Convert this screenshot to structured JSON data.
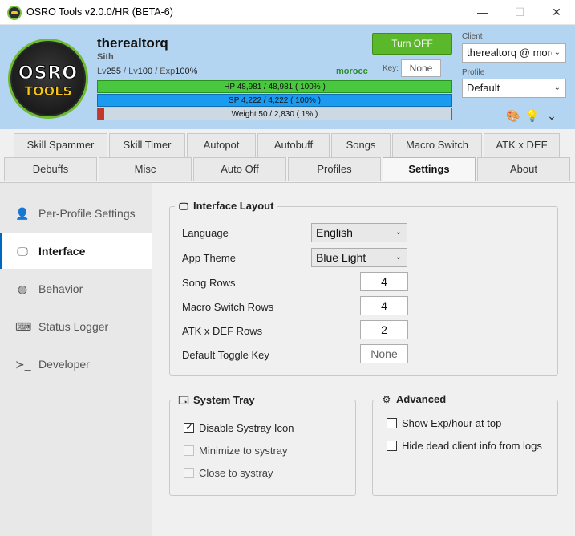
{
  "window": {
    "title": "OSRO Tools v2.0.0/HR (BETA-6)",
    "min_glyph": "—",
    "max_glyph": "☐",
    "close_glyph": "✕",
    "app_icon": "osro-app-icon"
  },
  "header": {
    "logo_top": "OSRO",
    "logo_bottom": "TOOLS",
    "character_name": "therealtorq",
    "character_class": "Sith",
    "lv_prefix": "Lv",
    "base_level": "255",
    "lv_sep1": " / Lv",
    "job_level": "100",
    "exp_sep": " / Exp",
    "exp_percent": "100%",
    "server": "morocc",
    "key_label": "Key:",
    "key_value": "None",
    "turn_off_label": "Turn OFF",
    "hp_text": "HP  48,981  /  48,981  ( 100% )",
    "sp_text": "SP  4,222  /  4,222  ( 100% )",
    "weight_text": "Weight  50  /  2,830  ( 1% )",
    "weight_fraction": 0.018,
    "client_label": "Client",
    "client_value": "therealtorq @ morc",
    "profile_label": "Profile",
    "profile_value": "Default",
    "caret": "⌄",
    "icons": [
      "palette-icon",
      "lightbulb-icon",
      "chevron-down-icon"
    ],
    "palette_glyph": "🎨",
    "bulb_glyph": "💡",
    "chevron_glyph": "⌄"
  },
  "tabs_row1": [
    "Skill Spammer",
    "Skill Timer",
    "Autopot",
    "Autobuff",
    "Songs",
    "Macro Switch",
    "ATK x DEF"
  ],
  "tabs_row2": [
    "Debuffs",
    "Misc",
    "Auto Off",
    "Profiles",
    "Settings",
    "About"
  ],
  "active_tab": "Settings",
  "sidebar": {
    "items": [
      {
        "label": "Per-Profile Settings",
        "icon": "person-icon",
        "glyph": "👤"
      },
      {
        "label": "Interface",
        "icon": "monitor-icon",
        "glyph": "🖵"
      },
      {
        "label": "Behavior",
        "icon": "globe-icon",
        "glyph": "◍"
      },
      {
        "label": "Status Logger",
        "icon": "keyboard-icon",
        "glyph": "⌨"
      },
      {
        "label": "Developer",
        "icon": "terminal-icon",
        "glyph": "≻_"
      }
    ],
    "active_index": 1
  },
  "interface_layout": {
    "title": "Interface Layout",
    "icon": "monitor-icon",
    "glyph": "🖵",
    "language_label": "Language",
    "language_value": "English",
    "theme_label": "App Theme",
    "theme_value": "Blue Light",
    "song_rows_label": "Song Rows",
    "song_rows_value": "4",
    "macro_rows_label": "Macro Switch Rows",
    "macro_rows_value": "4",
    "atk_rows_label": "ATK x DEF Rows",
    "atk_rows_value": "2",
    "toggle_key_label": "Default Toggle Key",
    "toggle_key_value": "None",
    "caret": "⌄"
  },
  "system_tray": {
    "title": "System Tray",
    "icon": "window-icon",
    "glyph": "🗔",
    "options": [
      {
        "label": "Disable Systray Icon",
        "checked": true,
        "enabled": true
      },
      {
        "label": "Minimize to systray",
        "checked": false,
        "enabled": false
      },
      {
        "label": "Close to systray",
        "checked": false,
        "enabled": false
      }
    ]
  },
  "advanced": {
    "title": "Advanced",
    "icon": "gear-icon",
    "glyph": "⚙",
    "options": [
      {
        "label": "Show Exp/hour at top",
        "checked": false
      },
      {
        "label": "Hide dead client info from logs",
        "checked": false
      }
    ]
  }
}
